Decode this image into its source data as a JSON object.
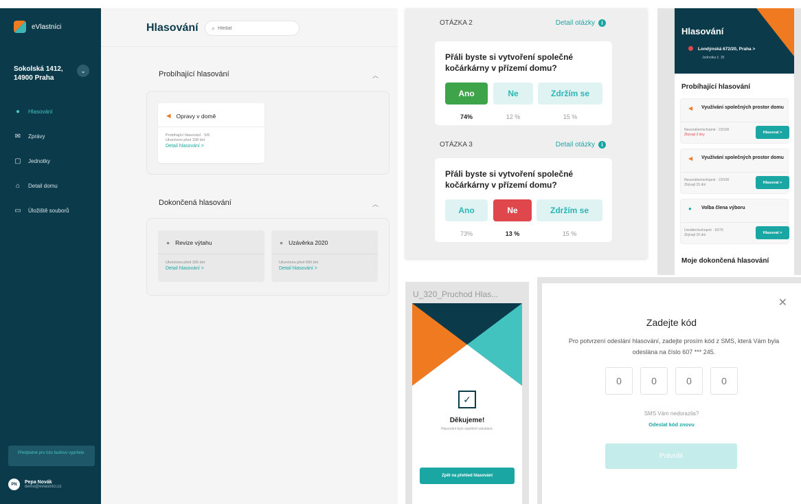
{
  "sidebar": {
    "logo_text": "eVlastníci",
    "building": "Sokolská 1412, 14900 Praha",
    "nav": [
      {
        "label": "Hlasování",
        "icon": "check-circle-icon"
      },
      {
        "label": "Zprávy",
        "icon": "mail-icon"
      },
      {
        "label": "Jednotky",
        "icon": "building-icon"
      },
      {
        "label": "Detail domu",
        "icon": "home-icon"
      },
      {
        "label": "Úložiště souborů",
        "icon": "folder-icon"
      }
    ],
    "promo": "Předplatné pro tuto budovu vypršelo.",
    "user": {
      "initials": "PN",
      "name": "Pepa Novák",
      "email": "demo@evlastnici.cz"
    }
  },
  "main": {
    "title": "Hlasování",
    "search_placeholder": "Hledat",
    "ongoing": {
      "title": "Probíhající hlasování",
      "cards": [
        {
          "title": "Opravy v domě",
          "meta1": "Probíhající hlasování · 5/8",
          "meta2": "Ukončeno před 338 dní",
          "link": "Detail hlasování  >"
        }
      ]
    },
    "finished": {
      "title": "Dokončená hlasování",
      "cards": [
        {
          "title": "Revize výtahu",
          "meta": "Ukončeno před 335 dní",
          "link": "Detail hlasování  >"
        },
        {
          "title": "Uzávěrka 2020",
          "meta": "Ukončeno před 690 dní",
          "link": "Detail hlasování  >"
        }
      ]
    }
  },
  "questions": [
    {
      "label": "OTÁZKA 2",
      "detail": "Detail otázky",
      "text": "Přáli byste si vytvoření společné kočárkárny v přízemí domu?",
      "options": [
        {
          "label": "Ano",
          "pct": "74%"
        },
        {
          "label": "Ne",
          "pct": "12 %"
        },
        {
          "label": "Zdržím se",
          "pct": "15 %"
        }
      ],
      "selected": 0
    },
    {
      "label": "OTÁZKA 3",
      "detail": "Detail otázky",
      "text": "Přáli byste si vytvoření společné kočárkárny v přízemí domu?",
      "options": [
        {
          "label": "Ano",
          "pct": "73%"
        },
        {
          "label": "Ne",
          "pct": "13 %"
        },
        {
          "label": "Zdržím se",
          "pct": "15 %"
        }
      ],
      "selected": 1
    }
  ],
  "mobile": {
    "title": "Hlasování",
    "address": "Londýnská 672/20, Praha >",
    "unit": "Jednotka č. 35",
    "ongoing_title": "Probíhající hlasování",
    "cards": [
      {
        "title": "Využívání společných prostor domu",
        "meta1": "Neusnášeníschopné · 23/100",
        "meta2": "Zbývají 3 dny",
        "button": "Hlasovat >"
      },
      {
        "title": "Využívání společných prostor domu",
        "meta1": "Neusnášeníschopné · 23/100",
        "meta2": "Zbývají 15 dní",
        "button": "Hlasovat >"
      },
      {
        "title": "Volba člena výboru",
        "meta1": "Usnášeníschopné · 62/76",
        "meta2": "Zbývají 15 dní",
        "button": "Hlasovat >"
      }
    ],
    "finished_title": "Moje dokončená hlasování"
  },
  "thanks": {
    "label": "U_320_Pruchod Hlas...",
    "title": "Děkujeme!",
    "subtitle": "Hlasování bylo úspěšně odesláno.",
    "button": "Zpět na přehled hlasování"
  },
  "modal": {
    "title": "Zadejte kód",
    "description": "Pro potvrzení odeslání hlasování, zadejte prosím kód z SMS, která Vám byla odeslána na číslo 607 *** 245.",
    "code_placeholder": "0",
    "not_received": "SMS Vám nedorazila?",
    "resend": "Odeslat kód znovu",
    "confirm": "Potvrdit"
  },
  "colors": {
    "navy": "#0b3a4b",
    "teal": "#1aa6a3",
    "orange": "#f07a1f",
    "green": "#3ea44a",
    "red": "#e0474c"
  }
}
